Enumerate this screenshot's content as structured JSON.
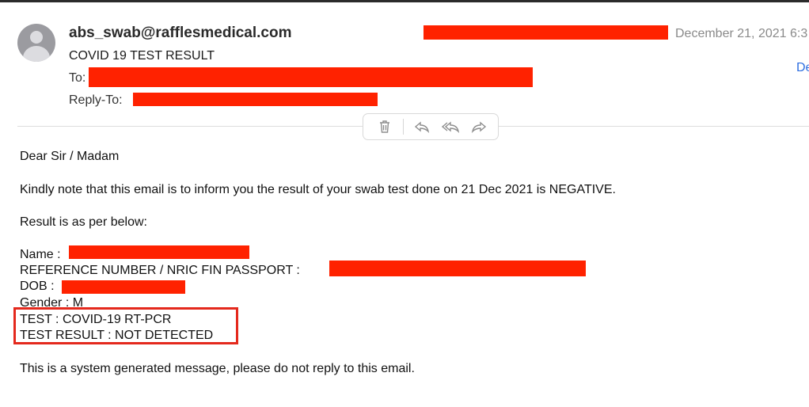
{
  "email": {
    "sender": "abs_swab@rafflesmedical.com",
    "subject": "COVID 19 TEST RESULT",
    "to_label": "To:",
    "reply_to_label": "Reply-To:",
    "date": "December 21, 2021 6:3",
    "details_link": "De"
  },
  "toolbar": {
    "icons": [
      "trash-icon",
      "reply-icon",
      "reply-all-icon",
      "forward-icon"
    ]
  },
  "body": {
    "greeting": "Dear Sir / Madam",
    "intro": "Kindly note that this email is to inform you the result of your swab test done on 21 Dec 2021 is NEGATIVE.",
    "result_heading": "Result is as per below:",
    "fields": {
      "name_label": "Name :",
      "reference_label": "REFERENCE NUMBER / NRIC FIN PASSPORT :",
      "dob_label": "DOB :",
      "gender": "Gender : M",
      "test": "TEST : COVID-19 RT-PCR",
      "test_result": "TEST RESULT : NOT DETECTED"
    },
    "footer": "This is a system generated message, please do not reply to this email."
  },
  "colors": {
    "redaction": "#ff2200",
    "highlight_border": "#e4291d",
    "link": "#2f6fe0",
    "date": "#8a8a8a"
  }
}
